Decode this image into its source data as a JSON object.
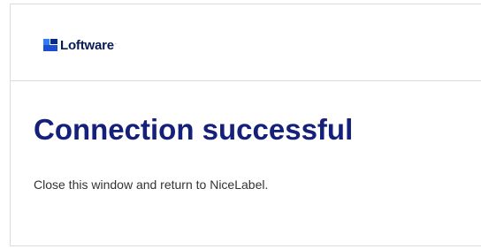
{
  "brand": {
    "logo_text": "Loftware",
    "trademark": "·",
    "colors": {
      "logo_light": "#2f7cf6",
      "logo_mid": "#1b4fd1",
      "logo_dark": "#0a2a8a",
      "text_navy": "#0a1d52",
      "title_blue": "#15207a"
    }
  },
  "main": {
    "title": "Connection successful",
    "message": "Close this window and return to NiceLabel."
  }
}
